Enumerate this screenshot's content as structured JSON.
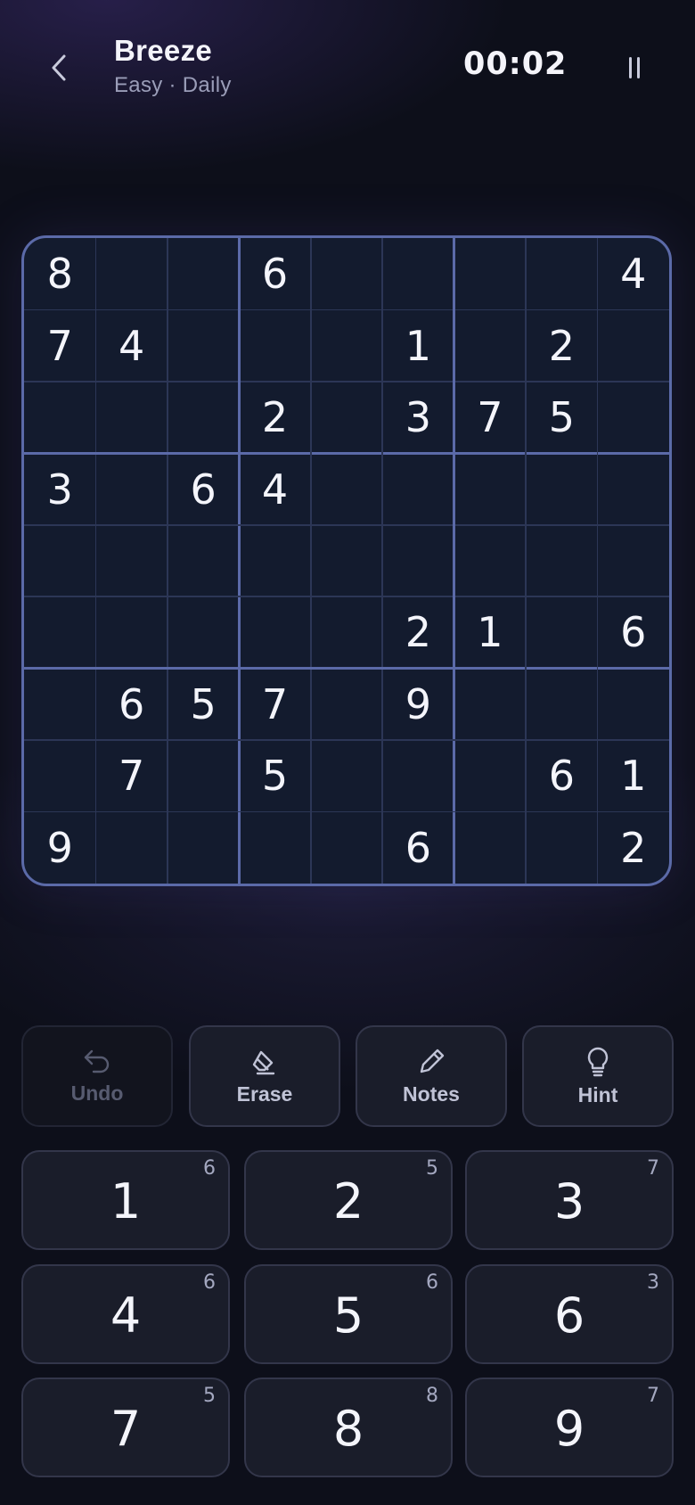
{
  "header": {
    "back_icon": "chevron-left-icon",
    "title": "Breeze",
    "subtitle": "Easy · Daily",
    "timer": "00:02",
    "pause_icon": "pause-icon"
  },
  "board": {
    "rows": [
      [
        "8",
        "",
        "",
        "6",
        "",
        "",
        "",
        "",
        "4"
      ],
      [
        "7",
        "4",
        "",
        "",
        "",
        "1",
        "",
        "2",
        ""
      ],
      [
        "",
        "",
        "",
        "2",
        "",
        "3",
        "7",
        "5",
        ""
      ],
      [
        "3",
        "",
        "6",
        "4",
        "",
        "",
        "",
        "",
        ""
      ],
      [
        "",
        "",
        "",
        "",
        "",
        "",
        "",
        "",
        ""
      ],
      [
        "",
        "",
        "",
        "",
        "",
        "2",
        "1",
        "",
        "6"
      ],
      [
        "",
        "6",
        "5",
        "7",
        "",
        "9",
        "",
        "",
        ""
      ],
      [
        "",
        "7",
        "",
        "5",
        "",
        "",
        "",
        "6",
        "1"
      ],
      [
        "9",
        "",
        "",
        "",
        "",
        "6",
        "",
        "",
        "2"
      ]
    ]
  },
  "actions": [
    {
      "label": "Undo",
      "icon": "undo-icon",
      "disabled": true
    },
    {
      "label": "Erase",
      "icon": "eraser-icon",
      "disabled": false
    },
    {
      "label": "Notes",
      "icon": "pencil-icon",
      "disabled": false
    },
    {
      "label": "Hint",
      "icon": "lightbulb-icon",
      "disabled": false
    }
  ],
  "numpad": [
    {
      "digit": "1",
      "remaining": "6"
    },
    {
      "digit": "2",
      "remaining": "5"
    },
    {
      "digit": "3",
      "remaining": "7"
    },
    {
      "digit": "4",
      "remaining": "6"
    },
    {
      "digit": "5",
      "remaining": "6"
    },
    {
      "digit": "6",
      "remaining": "3"
    },
    {
      "digit": "7",
      "remaining": "5"
    },
    {
      "digit": "8",
      "remaining": "8"
    },
    {
      "digit": "9",
      "remaining": "7"
    }
  ],
  "colors": {
    "background": "#0d0f1a",
    "board": "#131b2e",
    "board_border": "#5b6aa8",
    "text": "#f4f5fb",
    "muted": "#9a9db8"
  }
}
